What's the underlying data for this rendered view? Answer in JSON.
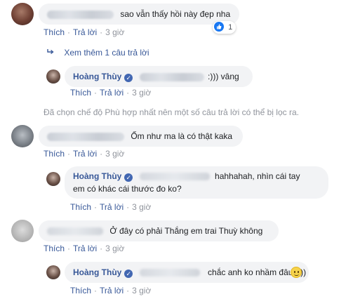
{
  "actions": {
    "like": "Thích",
    "reply": "Trả lời",
    "separator": "·",
    "time": "3 giờ"
  },
  "comments": [
    {
      "text": "sao vẫn thấy hồi này đẹp nha",
      "like_count": "1"
    },
    {
      "text": "Ốm như ma là có thật kaka"
    },
    {
      "text": "Ở đây có phải Thắng em trai Thuỳ không"
    }
  ],
  "more_replies": "Xem thêm 1 câu trả lời",
  "filter_notice": "Đã chọn chế độ Phù hợp nhất nên một số câu trả lời có thể bị lọc ra.",
  "replies": [
    {
      "author": "Hoàng Thùy",
      "text": ":))) vâng"
    },
    {
      "author": "Hoàng Thùy",
      "line1": "hahhahah, nhìn cái tay",
      "line2": "em có khác cái thước đo ko?"
    },
    {
      "author": "Hoàng Thùy",
      "text": "chắc anh ko nhầm đâu :)))"
    }
  ],
  "icons": {
    "verified": "verified-badge-icon",
    "like_reaction": "thumbs-up-icon",
    "reply_arrow": "reply-arrow-icon",
    "smiley": "smiley-face-icon"
  },
  "colors": {
    "link": "#385898",
    "bubble": "#f2f3f5",
    "muted": "#90949c",
    "like_blue": "#1877f2"
  }
}
